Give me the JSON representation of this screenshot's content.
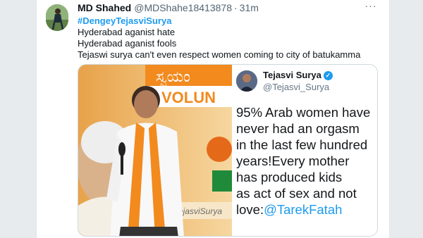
{
  "tweet": {
    "author_name": "MD Shahed",
    "author_handle": "@MDShahe18413878",
    "separator": "·",
    "time": "31m",
    "hashtag": "#DengeyTejasviSurya",
    "lines": [
      "Hyderabad aganist hate",
      "Hyderabad aganist fools",
      "Tejaswi surya can't even respect women coming to city of batukamma"
    ]
  },
  "embedded_tweet": {
    "name": "Tejasvi Surya",
    "handle": "@Tejasvi_Surya",
    "text_lines": [
      "95% Arab women have",
      "never had an orgasm",
      "in the last few hundred",
      "years!Every mother",
      "has produced kids",
      "as act of sex and not"
    ],
    "last_line_prefix": "love:",
    "mention": "@TarekFatah"
  },
  "photo": {
    "banner_text": "VOLUN",
    "banner_script": "ಸ್ವಯಂ",
    "backdrop_text": "ejasviSurya"
  },
  "colors": {
    "accent": "#1d9bf0",
    "saffron": "#f28a1e",
    "banner_green": "#1f8a3a"
  }
}
